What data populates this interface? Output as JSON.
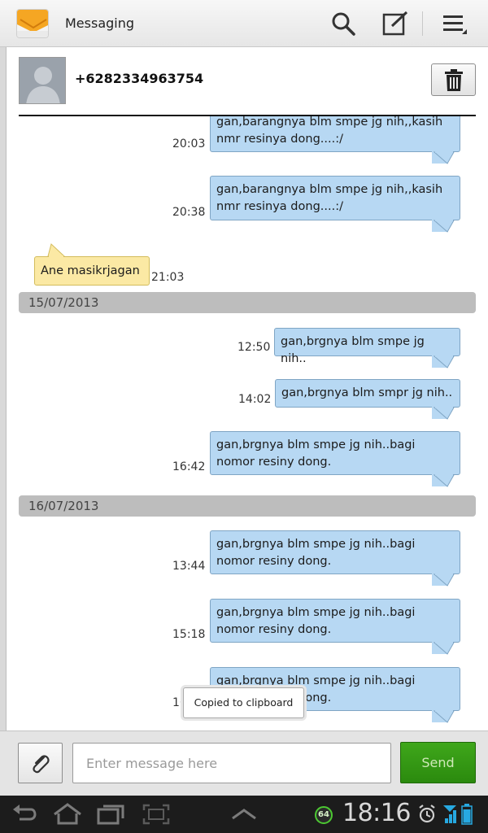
{
  "app": {
    "title": "Messaging"
  },
  "contact": {
    "number": "+6282334963754"
  },
  "messages": [
    {
      "dir": "out",
      "time": "20:03",
      "text": "gan,barangnya blm smpe jg nih,,kasih nmr resinya dong....:/"
    },
    {
      "dir": "out",
      "time": "20:38",
      "text": "gan,barangnya blm smpe jg nih,,kasih nmr resinya dong....:/"
    },
    {
      "dir": "in",
      "time": "21:03",
      "text": "Ane masikrjagan"
    },
    {
      "date": "15/07/2013"
    },
    {
      "dir": "out",
      "time": "12:50",
      "text": "gan,brgnya blm smpe jg nih.."
    },
    {
      "dir": "out",
      "time": "14:02",
      "text": "gan,brgnya blm smpr jg nih.."
    },
    {
      "dir": "out",
      "time": "16:42",
      "text": "gan,brgnya blm smpe jg nih..bagi nomor resiny dong."
    },
    {
      "date": "16/07/2013"
    },
    {
      "dir": "out",
      "time": "13:44",
      "text": "gan,brgnya blm smpe jg nih..bagi nomor resiny dong."
    },
    {
      "dir": "out",
      "time": "15:18",
      "text": "gan,brgnya blm smpe jg nih..bagi nomor resiny dong."
    },
    {
      "dir": "out",
      "time": "16",
      "text": "gan,brgnya blm smpe jg nih..bagi nomor resiny dong."
    }
  ],
  "toast": {
    "text": "Copied to clipboard"
  },
  "composer": {
    "placeholder": "Enter message here",
    "send_label": "Send"
  },
  "status": {
    "clock": "18:16",
    "badge": "64"
  },
  "colors": {
    "outgoing_bubble": "#b7d8f3",
    "incoming_bubble": "#fbe9a4",
    "send_button": "#34991a",
    "app_icon": "#f5a623"
  }
}
